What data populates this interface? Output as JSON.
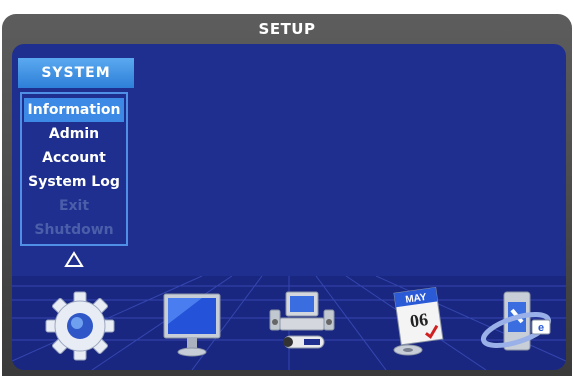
{
  "window": {
    "title": "SETUP"
  },
  "menu": {
    "header": "SYSTEM",
    "items": [
      {
        "label": "Information",
        "state": "selected"
      },
      {
        "label": "Admin",
        "state": "normal"
      },
      {
        "label": "Account",
        "state": "normal"
      },
      {
        "label": "System Log",
        "state": "normal"
      },
      {
        "label": "Exit",
        "state": "disabled"
      },
      {
        "label": "Shutdown",
        "state": "disabled"
      }
    ]
  },
  "calendar": {
    "month": "MAY",
    "day": "06"
  },
  "icons": {
    "bottom_row": [
      "gear-icon",
      "monitor-icon",
      "computer-devices-icon",
      "calendar-icon",
      "network-icon"
    ],
    "scroll_up": "up-triangle-icon"
  },
  "colors": {
    "panel": "#1f2f8f",
    "menu_header": "#3d8ae6",
    "selected_item": "#3d8ae6",
    "disabled_text": "#4b5eaa"
  }
}
